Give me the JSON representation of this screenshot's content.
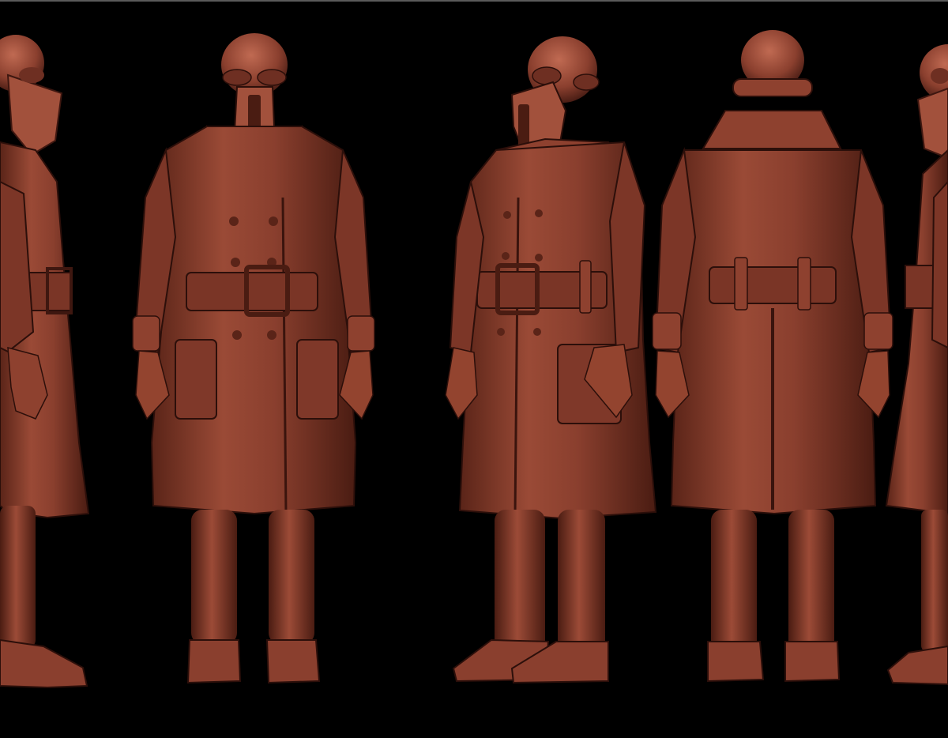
{
  "scene": {
    "background_color": "#000000",
    "top_line_color": "#5a5a5a",
    "clay_colors": {
      "base": "#8a3f2e",
      "light": "#b0604a",
      "mid": "#6e2f22",
      "dark": "#3e1710",
      "shadow": "#260d08"
    },
    "views": [
      {
        "name": "side-left",
        "facing": "left",
        "cropped": true
      },
      {
        "name": "front",
        "facing": "front",
        "cropped": false
      },
      {
        "name": "three-quarter",
        "facing": "three-quarter-left",
        "cropped": false
      },
      {
        "name": "back",
        "facing": "back",
        "cropped": false
      },
      {
        "name": "side-right",
        "facing": "right",
        "cropped": true
      }
    ]
  }
}
